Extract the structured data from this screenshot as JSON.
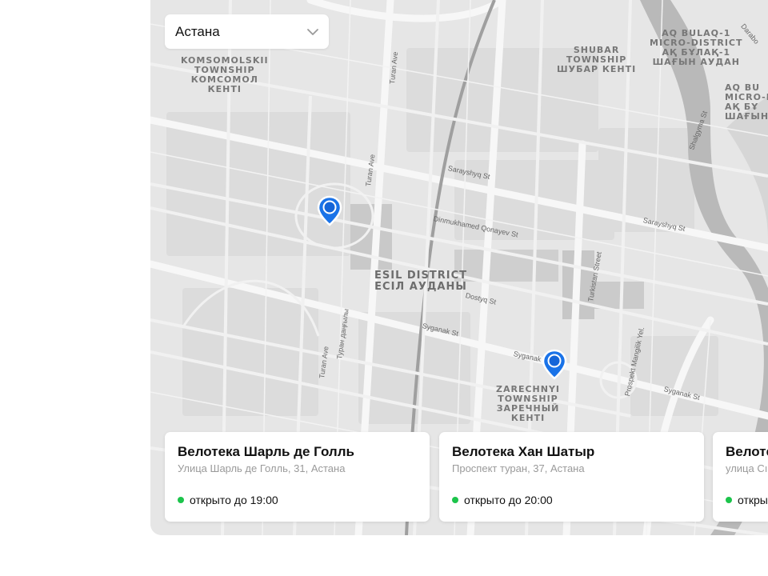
{
  "city_select": {
    "value": "Астана"
  },
  "map_labels": {
    "komsomolskii": "KOMSOMOLSKII\nTOWNSHIP\nКОМСОМОЛ\nКЕНТІ",
    "shubar": "SHUBAR\nTOWNSHIP\nШУБАР КЕНТІ",
    "aq_bulaq": "AQ BULAQ-1\nMICRO-DISTRICT\nАҚ БҰЛАҚ-1\nШАҒЫН АУДАН",
    "aq_bulaq_2": "AQ BU\nMICRO-D\nАҚ БҰ\nШАҒЫН",
    "esil": "ESIL DISTRICT\nЕСІЛ АУДАНЫ",
    "zarechnyi": "ZARECHNYI\nTOWNSHIP\nЗАРЕЧНЫЙ\nКЕНТІ"
  },
  "streets": {
    "turan1": "Turan Ave",
    "turan2": "Turan Ave",
    "sarayshyq1": "Sarayshyq St",
    "sarayshyq2": "Sarayshyq St",
    "dinmukhamed": "Dinmukhamed Qonayev St",
    "dostyq": "Dostyq St",
    "syganak1": "Syganak St",
    "syganak2": "Syganak",
    "syganak3": "Syganak St",
    "turkistan": "Turkistan Street",
    "turan_kz": "Туран даңғылы",
    "turan3": "Turan Ave",
    "mangilik": "Prospekt Mangilik Yel.",
    "shalgyma": "Shalgyma St",
    "darabo": "Darabo"
  },
  "cards": [
    {
      "title": "Велотека Шарль де Голль",
      "address": "Улица Шарль де Голль, 31, Астана",
      "status": "открыто до 19:00"
    },
    {
      "title": "Велотека Хан Шатыр",
      "address": "Проспект туран, 37, Астана",
      "status": "открыто до 20:00"
    },
    {
      "title": "Велоте",
      "address": "улица Сı",
      "status": "откры"
    }
  ],
  "colors": {
    "pin": "#1a73e8",
    "status_open": "#1cc44b",
    "map_bg": "#e6e6e6",
    "river": "#b9b9b9"
  }
}
